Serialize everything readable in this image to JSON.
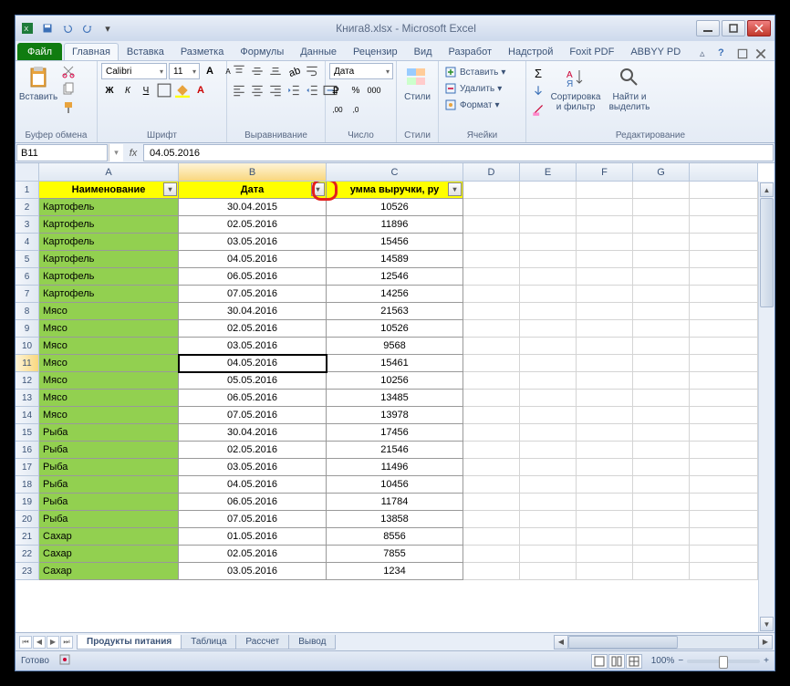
{
  "title": "Книга8.xlsx - Microsoft Excel",
  "qat": {
    "save": "save",
    "undo": "undo",
    "redo": "redo",
    "print": "print"
  },
  "tabs": {
    "file": "Файл",
    "items": [
      "Главная",
      "Вставка",
      "Разметка",
      "Формулы",
      "Данные",
      "Рецензир",
      "Вид",
      "Разработ",
      "Надстрой",
      "Foxit PDF",
      "ABBYY PD"
    ],
    "active": 0
  },
  "ribbon": {
    "clipboard": {
      "paste": "Вставить",
      "label": "Буфер обмена"
    },
    "font": {
      "name": "Calibri",
      "size": "11",
      "label": "Шрифт"
    },
    "align": {
      "label": "Выравнивание"
    },
    "number": {
      "format": "Дата",
      "label": "Число"
    },
    "styles": {
      "label": "Стили",
      "btn": "Стили"
    },
    "cells": {
      "insert": "Вставить",
      "delete": "Удалить",
      "format": "Формат",
      "label": "Ячейки"
    },
    "editing": {
      "sort": "Сортировка и фильтр",
      "find": "Найти и выделить",
      "label": "Редактирование"
    }
  },
  "namebox": "B11",
  "formula": "04.05.2016",
  "columns": [
    "A",
    "B",
    "C",
    "D",
    "E",
    "F",
    "G"
  ],
  "headers": {
    "A": "Наименование",
    "B": "Дата",
    "C": "умма выручки, ру"
  },
  "active_cell": {
    "row": 11,
    "col": "B"
  },
  "rows": [
    {
      "n": 2,
      "A": "Картофель",
      "B": "30.04.2015",
      "C": "10526"
    },
    {
      "n": 3,
      "A": "Картофель",
      "B": "02.05.2016",
      "C": "11896"
    },
    {
      "n": 4,
      "A": "Картофель",
      "B": "03.05.2016",
      "C": "15456"
    },
    {
      "n": 5,
      "A": "Картофель",
      "B": "04.05.2016",
      "C": "14589"
    },
    {
      "n": 6,
      "A": "Картофель",
      "B": "06.05.2016",
      "C": "12546"
    },
    {
      "n": 7,
      "A": "Картофель",
      "B": "07.05.2016",
      "C": "14256"
    },
    {
      "n": 8,
      "A": "Мясо",
      "B": "30.04.2016",
      "C": "21563"
    },
    {
      "n": 9,
      "A": "Мясо",
      "B": "02.05.2016",
      "C": "10526"
    },
    {
      "n": 10,
      "A": "Мясо",
      "B": "03.05.2016",
      "C": "9568"
    },
    {
      "n": 11,
      "A": "Мясо",
      "B": "04.05.2016",
      "C": "15461"
    },
    {
      "n": 12,
      "A": "Мясо",
      "B": "05.05.2016",
      "C": "10256"
    },
    {
      "n": 13,
      "A": "Мясо",
      "B": "06.05.2016",
      "C": "13485"
    },
    {
      "n": 14,
      "A": "Мясо",
      "B": "07.05.2016",
      "C": "13978"
    },
    {
      "n": 15,
      "A": "Рыба",
      "B": "30.04.2016",
      "C": "17456"
    },
    {
      "n": 16,
      "A": "Рыба",
      "B": "02.05.2016",
      "C": "21546"
    },
    {
      "n": 17,
      "A": "Рыба",
      "B": "03.05.2016",
      "C": "11496"
    },
    {
      "n": 18,
      "A": "Рыба",
      "B": "04.05.2016",
      "C": "10456"
    },
    {
      "n": 19,
      "A": "Рыба",
      "B": "06.05.2016",
      "C": "11784"
    },
    {
      "n": 20,
      "A": "Рыба",
      "B": "07.05.2016",
      "C": "13858"
    },
    {
      "n": 21,
      "A": "Сахар",
      "B": "01.05.2016",
      "C": "8556"
    },
    {
      "n": 22,
      "A": "Сахар",
      "B": "02.05.2016",
      "C": "7855"
    },
    {
      "n": 23,
      "A": "Сахар",
      "B": "03.05.2016",
      "C": "1234"
    }
  ],
  "sheets": {
    "items": [
      "Продукты питания",
      "Таблица",
      "Рассчет",
      "Вывод"
    ],
    "active": 0
  },
  "status": {
    "ready": "Готово",
    "zoom": "100%"
  }
}
